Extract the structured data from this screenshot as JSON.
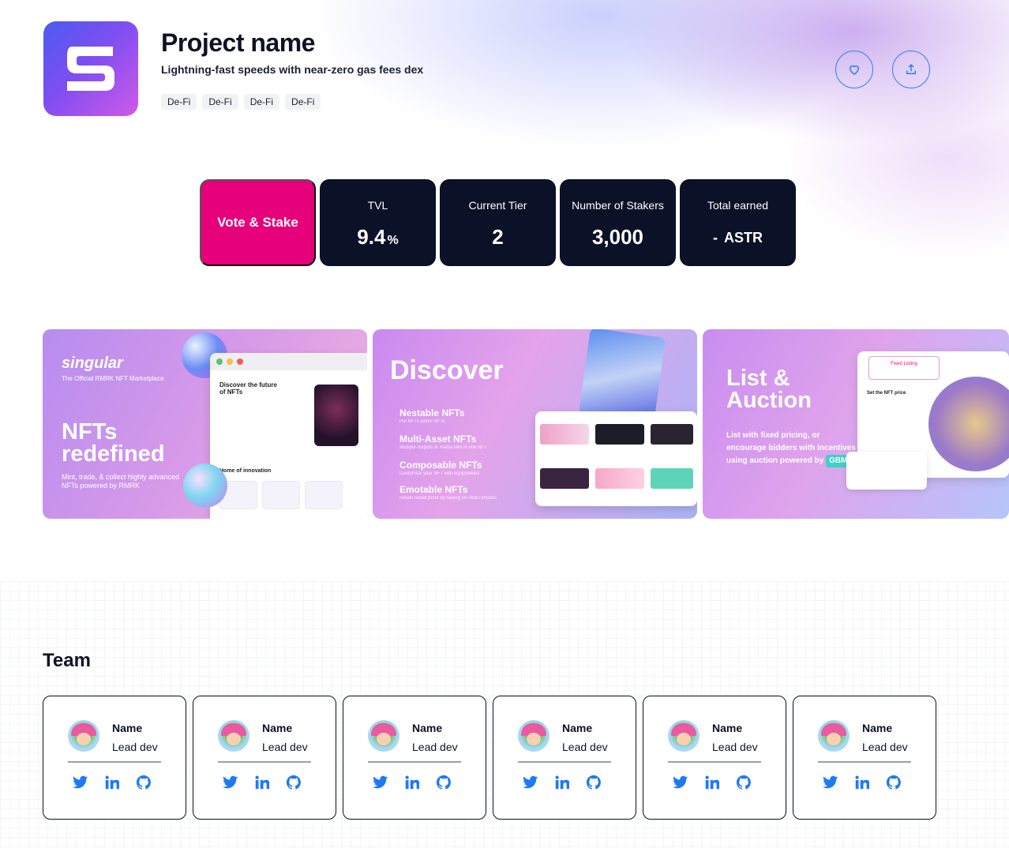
{
  "project": {
    "name": "Project name",
    "subtitle": "Lightning-fast speeds with near-zero gas fees dex",
    "tags": [
      "De-Fi",
      "De-Fi",
      "De-Fi",
      "De-Fi"
    ],
    "logo_icon": "s-logo-icon"
  },
  "actions": {
    "favorite_icon": "heart-icon",
    "share_icon": "share-upload-icon"
  },
  "stats": {
    "vote_label": "Vote & Stake",
    "tvl_label": "TVL",
    "tvl_value": "9.4",
    "tvl_unit": "%",
    "tier_label": "Current Tier",
    "tier_value": "2",
    "stakers_label": "Number of Stakers",
    "stakers_value": "3,000",
    "earned_label": "Total earned",
    "earned_value": "-",
    "earned_unit": "ASTR"
  },
  "banners": [
    {
      "brand": "singular",
      "brand_sub": "The Official RMRK NFT Marketplace",
      "headline": "NFTs redefined",
      "description": "Mint, trade, & collect highly advanced NFTs powered by RMRK",
      "mock_title": "Discover the future of NFTs",
      "mock_section": "Home of innovation"
    },
    {
      "headline": "Discover",
      "features": [
        {
          "title": "Nestable NFTs",
          "sub": "Put NFTs within NFTs"
        },
        {
          "title": "Multi-Asset NFTs",
          "sub": "Multiple outputs or media files in one NFT"
        },
        {
          "title": "Composable NFTs",
          "sub": "Customize your NFT with equippables"
        },
        {
          "title": "Emotable NFTs",
          "sub": "Retain social proof by having on-chain emotes"
        }
      ]
    },
    {
      "headline": "List & Auction",
      "description": "List with fixed pricing, or encourage bidders with incentives using auction powered by",
      "badge": "GBM",
      "panel_tab": "Fixed Listing",
      "panel_label": "Set the NFT price"
    }
  ],
  "team": {
    "title": "Team",
    "members": [
      {
        "name": "Name",
        "role": "Lead dev"
      },
      {
        "name": "Name",
        "role": "Lead dev"
      },
      {
        "name": "Name",
        "role": "Lead dev"
      },
      {
        "name": "Name",
        "role": "Lead dev"
      },
      {
        "name": "Name",
        "role": "Lead dev"
      },
      {
        "name": "Name",
        "role": "Lead dev"
      }
    ],
    "social_icons": [
      "twitter-icon",
      "linkedin-icon",
      "github-icon"
    ]
  },
  "colors": {
    "accent_pink": "#e6007a",
    "dark_navy": "#0b1127",
    "link_blue": "#2f7cf6"
  }
}
